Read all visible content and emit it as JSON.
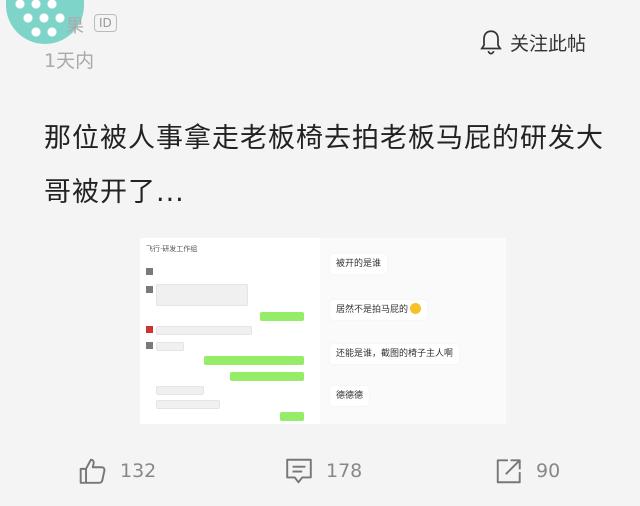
{
  "header": {
    "username": "果",
    "id_badge": "ID",
    "time": "1天内",
    "follow_label": "关注此帖"
  },
  "post": {
    "title": "那位被人事拿走老板椅去拍老板马屁的研发大哥被开了..."
  },
  "screenshot": {
    "chat_header": "飞行·研发工作组",
    "bubbles": [
      "被开的是谁",
      "居然不是拍马屁的",
      "还能是谁，截图的椅子主人啊",
      "德德德"
    ]
  },
  "actions": {
    "likes": "132",
    "comments": "178",
    "shares": "90"
  },
  "colors": {
    "avatar": "#7fd4c9",
    "chat_green": "#95ec69",
    "muted": "#888888"
  },
  "icons": [
    "bell-icon",
    "thumbs-up-icon",
    "comment-icon",
    "share-icon"
  ]
}
